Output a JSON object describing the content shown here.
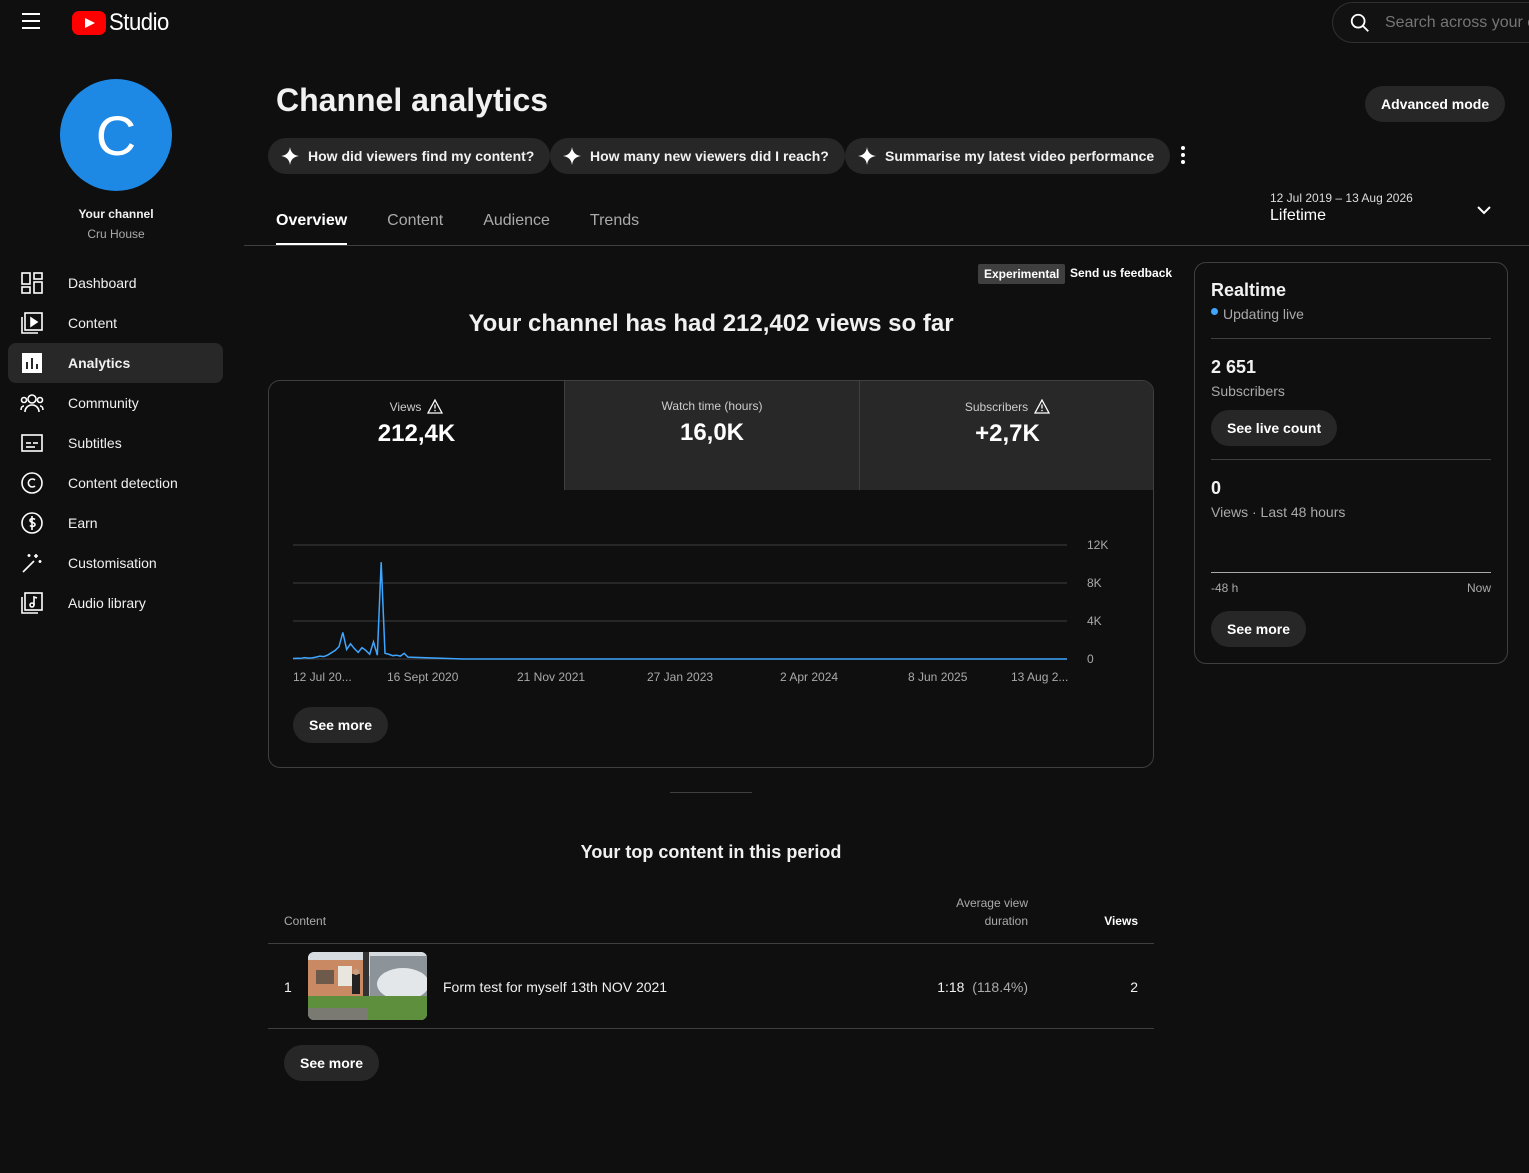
{
  "topbar": {
    "logo_text": "Studio",
    "search_placeholder": "Search across your channel"
  },
  "sidebar": {
    "avatar_letter": "C",
    "your_channel": "Your channel",
    "channel_name": "Cru House",
    "items": [
      {
        "label": "Dashboard",
        "icon": "dashboard-icon"
      },
      {
        "label": "Content",
        "icon": "content-icon"
      },
      {
        "label": "Analytics",
        "icon": "analytics-icon",
        "active": true
      },
      {
        "label": "Community",
        "icon": "community-icon"
      },
      {
        "label": "Subtitles",
        "icon": "subtitles-icon"
      },
      {
        "label": "Content detection",
        "icon": "copyright-icon"
      },
      {
        "label": "Earn",
        "icon": "dollar-icon"
      },
      {
        "label": "Customisation",
        "icon": "magic-wand-icon"
      },
      {
        "label": "Audio library",
        "icon": "audio-library-icon"
      }
    ]
  },
  "header": {
    "title": "Channel analytics",
    "advanced_mode": "Advanced mode",
    "chips": [
      "How did viewers find my content?",
      "How many new viewers did I reach?",
      "Summarise my latest video performance"
    ],
    "tabs": [
      "Overview",
      "Content",
      "Audience",
      "Trends"
    ],
    "active_tab": "Overview",
    "date_range": "12 Jul 2019 – 13 Aug 2026",
    "date_period": "Lifetime"
  },
  "overview": {
    "experimental": "Experimental",
    "feedback": "Send us feedback",
    "headline": "Your channel has had 212,402 views so far",
    "metrics": [
      {
        "label": "Views",
        "value": "212,4K",
        "warning": true
      },
      {
        "label": "Watch time (hours)",
        "value": "16,0K",
        "warning": false
      },
      {
        "label": "Subscribers",
        "value": "+2,7K",
        "warning": true
      }
    ],
    "see_more": "See more"
  },
  "chart_data": {
    "type": "line",
    "title": "",
    "series": [
      {
        "values": [
          50,
          80,
          60,
          150,
          90,
          120,
          200,
          300,
          250,
          400,
          650,
          900,
          1300,
          2800,
          1000,
          1600,
          1100,
          700,
          1200,
          900,
          500,
          1800,
          400,
          10200,
          600,
          500,
          350,
          400,
          300,
          600,
          200,
          0,
          0,
          0,
          0,
          0,
          0,
          0,
          0,
          0,
          0,
          0,
          0
        ]
      }
    ],
    "x_tick_labels": [
      "12 Jul 20...",
      "16 Sept 2020",
      "21 Nov 2021",
      "27 Jan 2023",
      "2 Apr 2024",
      "8 Jun 2025",
      "13 Aug 2..."
    ],
    "y_tick_labels": [
      "12K",
      "8K",
      "4K",
      "0"
    ],
    "ylim": [
      0,
      12000
    ],
    "ylabel_side": "right",
    "grid": true,
    "color": "#3ea6ff"
  },
  "top_content": {
    "title": "Your top content in this period",
    "col_content": "Content",
    "col_avd_1": "Average view",
    "col_avd_2": "duration",
    "col_views": "Views",
    "rows": [
      {
        "rank": "1",
        "title": "Form test for myself 13th NOV 2021",
        "duration": "1:18",
        "percent": "(118.4%)",
        "views": "2"
      }
    ],
    "see_more": "See more"
  },
  "realtime": {
    "title": "Realtime",
    "status": "Updating live",
    "subscribers_value": "2 651",
    "subscribers_label": "Subscribers",
    "see_live_count": "See live count",
    "views_value": "0",
    "views_label": "Views · Last 48 hours",
    "axis_start": "-48 h",
    "axis_end": "Now",
    "see_more": "See more"
  }
}
